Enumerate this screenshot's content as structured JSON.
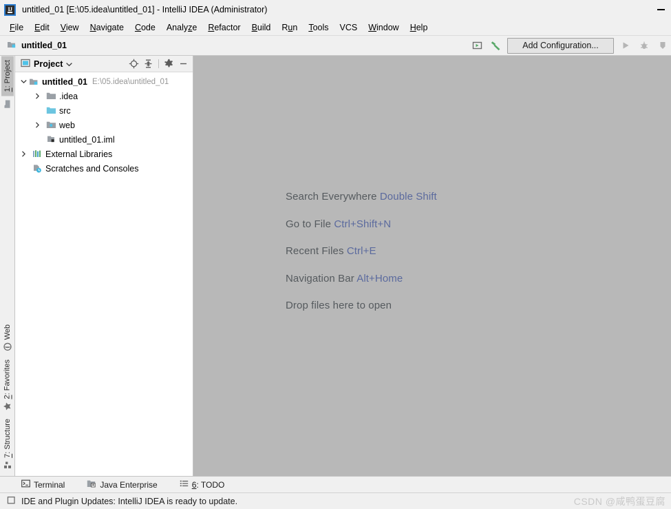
{
  "window": {
    "title": "untitled_01 [E:\\05.idea\\untitled_01] - IntelliJ IDEA (Administrator)",
    "app_icon": "intellij-idea-icon",
    "minimize_label": "—"
  },
  "menubar": {
    "items": [
      {
        "label": "File",
        "mnemonic": "F"
      },
      {
        "label": "Edit",
        "mnemonic": "E"
      },
      {
        "label": "View",
        "mnemonic": "V"
      },
      {
        "label": "Navigate",
        "mnemonic": "N"
      },
      {
        "label": "Code",
        "mnemonic": "C"
      },
      {
        "label": "Analyze",
        "mnemonic": "z"
      },
      {
        "label": "Refactor",
        "mnemonic": "R"
      },
      {
        "label": "Build",
        "mnemonic": "B"
      },
      {
        "label": "Run",
        "mnemonic": "u"
      },
      {
        "label": "Tools",
        "mnemonic": "T"
      },
      {
        "label": "VCS",
        "mnemonic": ""
      },
      {
        "label": "Window",
        "mnemonic": "W"
      },
      {
        "label": "Help",
        "mnemonic": "H"
      }
    ]
  },
  "navbar": {
    "breadcrumb": "untitled_01",
    "breadcrumb_icon": "module-icon",
    "select_in_icon": "select-target-icon",
    "build_icon": "build-hammer-icon",
    "add_configuration": "Add Configuration...",
    "run_icon": "run-icon",
    "debug_icon": "debug-icon",
    "more_icon": "more-icon"
  },
  "left_strip": {
    "top_tabs": [
      {
        "label": "1: Project",
        "mnemonic": "1",
        "icon": "project-folder-icon",
        "active": true
      }
    ],
    "bottom_tabs": [
      {
        "label": "Web",
        "mnemonic": "",
        "icon": "web-globe-icon",
        "active": false
      },
      {
        "label": "2: Favorites",
        "mnemonic": "2",
        "icon": "favorites-star-icon",
        "active": false
      },
      {
        "label": "7: Structure",
        "mnemonic": "7",
        "icon": "structure-icon",
        "active": false
      }
    ]
  },
  "project_panel": {
    "title": "Project",
    "dropdown_icon": "chevron-down-icon",
    "view_icon": "project-view-icon",
    "actions": [
      {
        "name": "locate-icon",
        "tooltip": "Select Opened File"
      },
      {
        "name": "collapse-all-icon",
        "tooltip": "Collapse All"
      },
      {
        "name": "gear-icon",
        "tooltip": "Settings"
      },
      {
        "name": "hide-icon",
        "tooltip": "Hide"
      }
    ],
    "tree": [
      {
        "label": "untitled_01",
        "path": "E:\\05.idea\\untitled_01",
        "icon": "module-icon",
        "depth": 0,
        "expanded": true,
        "has_arrow": true,
        "bold": true
      },
      {
        "label": ".idea",
        "path": "",
        "icon": "folder-icon",
        "depth": 1,
        "expanded": false,
        "has_arrow": true,
        "bold": false
      },
      {
        "label": "src",
        "path": "",
        "icon": "source-folder-icon",
        "depth": 1,
        "expanded": false,
        "has_arrow": false,
        "bold": false
      },
      {
        "label": "web",
        "path": "",
        "icon": "web-folder-icon",
        "depth": 1,
        "expanded": false,
        "has_arrow": true,
        "bold": false
      },
      {
        "label": "untitled_01.iml",
        "path": "",
        "icon": "iml-file-icon",
        "depth": 1,
        "expanded": false,
        "has_arrow": false,
        "bold": false
      },
      {
        "label": "External Libraries",
        "path": "",
        "icon": "libraries-icon",
        "depth": 0,
        "expanded": false,
        "has_arrow": true,
        "bold": false
      },
      {
        "label": "Scratches and Consoles",
        "path": "",
        "icon": "scratches-icon",
        "depth": 0,
        "expanded": false,
        "has_arrow": false,
        "bold": false
      }
    ]
  },
  "editor": {
    "hints": [
      {
        "label": "Search Everywhere",
        "shortcut": "Double Shift"
      },
      {
        "label": "Go to File",
        "shortcut": "Ctrl+Shift+N"
      },
      {
        "label": "Recent Files",
        "shortcut": "Ctrl+E"
      },
      {
        "label": "Navigation Bar",
        "shortcut": "Alt+Home"
      },
      {
        "label": "Drop files here to open",
        "shortcut": ""
      }
    ]
  },
  "bottom_tabs": [
    {
      "label": "Terminal",
      "mnemonic": "",
      "icon": "terminal-icon"
    },
    {
      "label": "Java Enterprise",
      "mnemonic": "",
      "icon": "java-enterprise-icon"
    },
    {
      "label": "6: TODO",
      "mnemonic": "6",
      "icon": "todo-list-icon"
    }
  ],
  "statusbar": {
    "icon": "notification-icon",
    "message": "IDE and Plugin Updates: IntelliJ IDEA is ready to update.",
    "watermark": "CSDN @咸鸭蛋豆腐"
  },
  "colors": {
    "accent_blue": "#2f7fd1",
    "editor_bg": "#b8b8b8",
    "panel_bg": "#f0f0f0",
    "tree_bg": "#ffffff",
    "hint_text": "#555a5e",
    "hint_key": "#5b6a9e",
    "folder_gray": "#9aa0a6",
    "folder_cyan": "#6cc5e0",
    "build_green": "#59a869"
  }
}
